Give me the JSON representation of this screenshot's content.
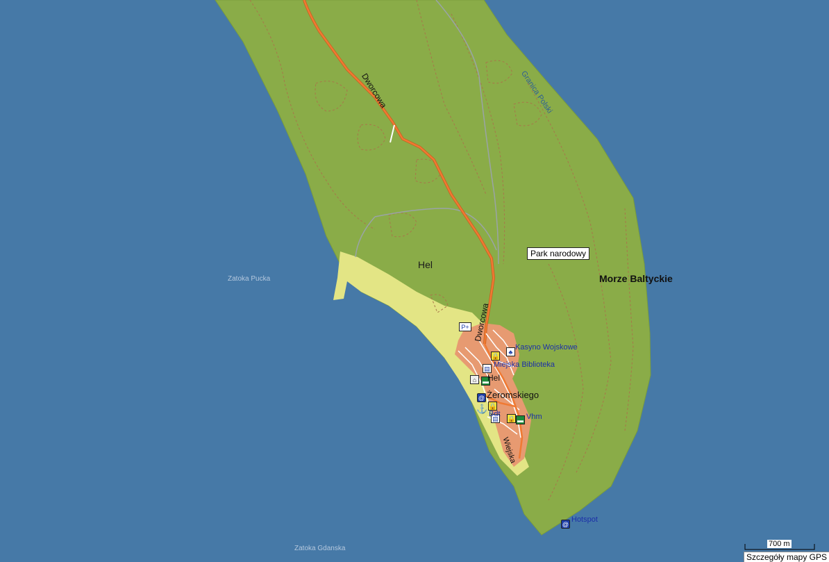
{
  "colors": {
    "water": "#4679a7",
    "forest": "#8aac48",
    "beach": "#e3e585",
    "urban": "#e79a71",
    "road": "#f07a33",
    "contour": "#a8764a",
    "rail": "#9aa4a6"
  },
  "labels": {
    "zatoka_pucka": "Zatoka Pucka",
    "zatoka_gdanska": "Zatoka Gdanska",
    "hel_area": "Hel",
    "morze": "Morze Baltyckie",
    "park": "Park narodowy",
    "granica": "Granica Polski",
    "dworcowa_north": "Dworcowa",
    "dworcowa_south": "Dworcowa",
    "kasyno": "Kasyno Wojskowe",
    "biblioteka": "Miejska Biblioteka",
    "hel_town": "Hel",
    "zeromskiego": "Żeromskiego",
    "bdt": "Bdt",
    "vhm": "Vhm",
    "wiejska": "Wiejska",
    "hotspot": "Hotspot"
  },
  "icons": [
    "info-icon",
    "lock-icon",
    "casino-icon",
    "library-icon",
    "house-icon",
    "hotel-icon",
    "hotspot-icon",
    "anchor-icon"
  ],
  "scale": {
    "text": "700 m"
  },
  "status": {
    "text": "Szczegóły mapy GPS"
  }
}
